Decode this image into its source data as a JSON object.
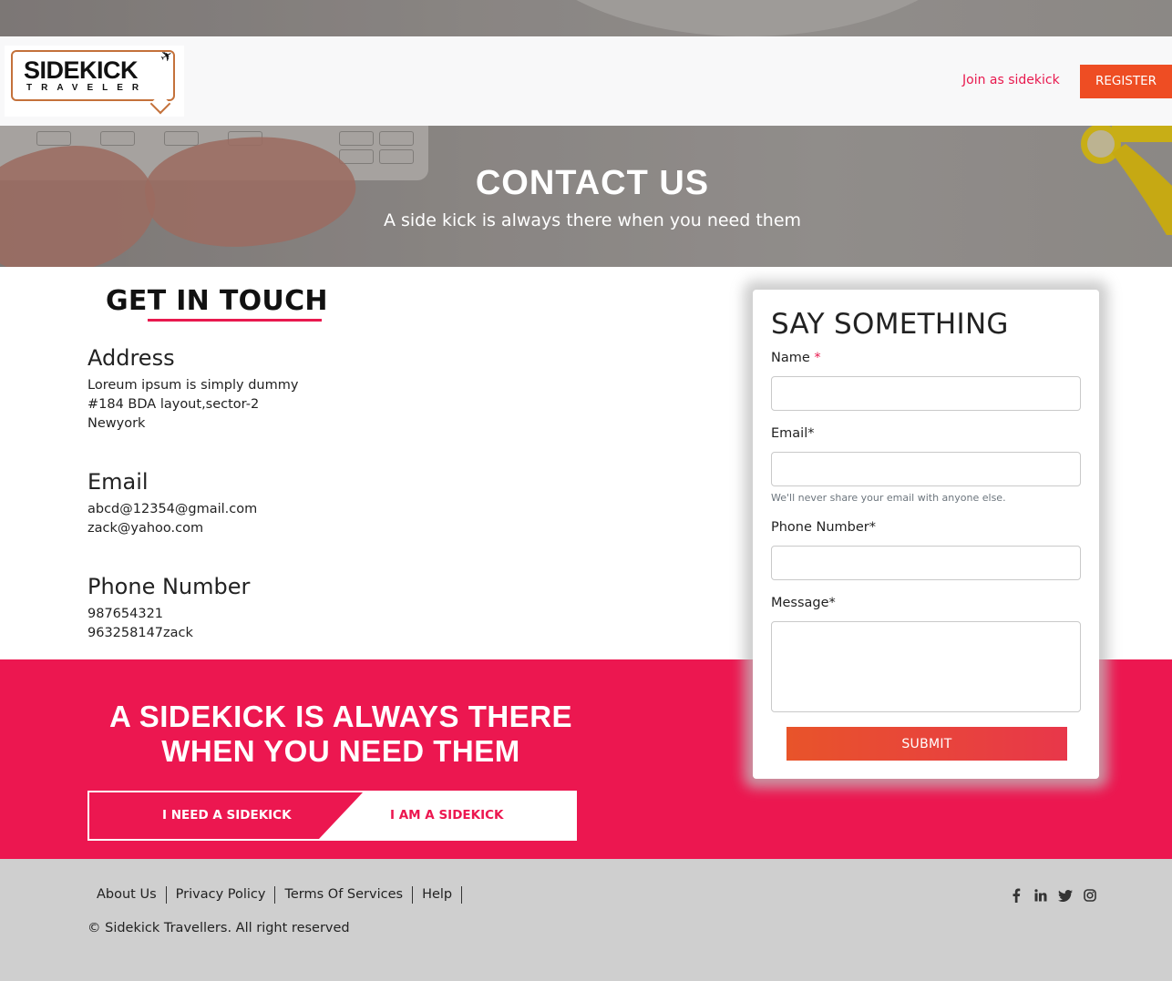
{
  "hero": {
    "title": "CONTACT US",
    "subtitle": "A side kick is always there when you need them"
  },
  "navbar": {
    "logo_main": "SIDEKICK",
    "logo_sub": "TRAVELER",
    "join_label": "Join as sidekick",
    "register_label": "REGISTER"
  },
  "get_in_touch": {
    "title": "GET IN TOUCH",
    "address": {
      "heading": "Address",
      "lines": [
        "Loreum ipsum is simply dummy",
        "#184 BDA layout,sector-2",
        "Newyork"
      ]
    },
    "email": {
      "heading": "Email",
      "lines": [
        "abcd@12354@gmail.com",
        "zack@yahoo.com"
      ]
    },
    "phone": {
      "heading": "Phone Number",
      "lines": [
        "987654321",
        "963258147zack"
      ]
    }
  },
  "form": {
    "title": "SAY SOMETHING",
    "name_label": "Name",
    "name_required_mark": "*",
    "name_value": "",
    "email_label": "Email*",
    "email_value": "",
    "email_help": "We'll never share your email with anyone else.",
    "phone_label": "Phone Number*",
    "phone_value": "",
    "message_label": "Message*",
    "message_value": "",
    "submit_label": "SUBMIT"
  },
  "banner": {
    "title_line1": "A SIDEKICK IS ALWAYS THERE",
    "title_line2": "WHEN YOU NEED THEM",
    "need_label": "I NEED A SIDEKICK",
    "am_label": "I AM A SIDEKICK"
  },
  "footer": {
    "links": [
      "About Us",
      "Privacy Policy",
      "Terms Of Services",
      "Help"
    ],
    "copyright": "© Sidekick Travellers. All right reserved",
    "social_icons": [
      "facebook-icon",
      "linkedin-icon",
      "twitter-icon",
      "instagram-icon"
    ]
  },
  "colors": {
    "accent_pink": "#ec1750",
    "accent_orange": "#ee4d23",
    "footer_bg": "#cfcfcf",
    "navbar_bg": "#f8f8f9"
  }
}
